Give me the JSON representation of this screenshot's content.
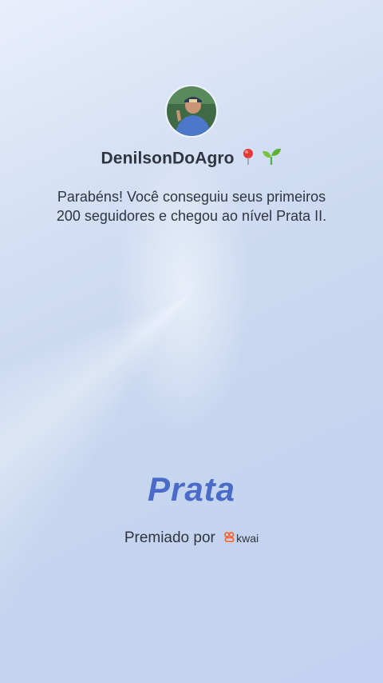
{
  "profile": {
    "username": "DenilsonDoAgro",
    "emoji": [
      "pin-emoji",
      "seedling-emoji"
    ]
  },
  "congrats": {
    "message": "Parabéns! Você conseguiu seus primeiros 200 seguidores e chegou ao nível Prata II."
  },
  "tier": {
    "label": "Prata"
  },
  "footer": {
    "awarded_by": "Premiado por",
    "brand": "kwai",
    "brand_color": "#ff5a1f"
  },
  "colors": {
    "tier_text": "#4a6bc7",
    "body_text": "#2f3440"
  }
}
